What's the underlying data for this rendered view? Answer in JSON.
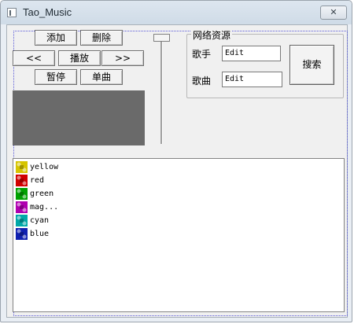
{
  "window": {
    "title": "Tao_Music",
    "close_glyph": "✕"
  },
  "controls": {
    "add": "添加",
    "delete": "删除",
    "prev": "<<",
    "play": "播放",
    "next": ">>",
    "pause": "暂停",
    "single": "单曲"
  },
  "network": {
    "group_title": "网络资源",
    "singer_label": "歌手",
    "singer_value": "Edit",
    "song_label": "歌曲",
    "song_value": "Edit",
    "search_label": "搜索"
  },
  "playlist": {
    "items": [
      {
        "label": "yellow",
        "color": "#d6c400"
      },
      {
        "label": "red",
        "color": "#d10000"
      },
      {
        "label": "green",
        "color": "#00a000"
      },
      {
        "label": "mag...",
        "color": "#b000b0"
      },
      {
        "label": "cyan",
        "color": "#00a8a8"
      },
      {
        "label": "blue",
        "color": "#1020b0"
      }
    ]
  }
}
